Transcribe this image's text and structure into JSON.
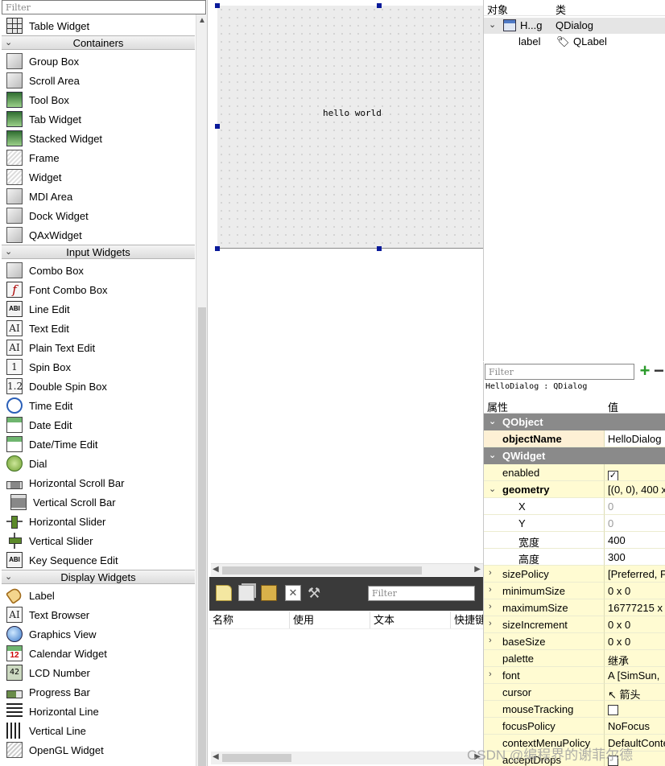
{
  "widget_box": {
    "filter_placeholder": "Filter",
    "items": [
      {
        "type": "item",
        "label": "Table Widget",
        "icon": "table-icon"
      },
      {
        "type": "category",
        "label": "Containers"
      },
      {
        "type": "item",
        "label": "Group Box",
        "icon": "group-box-icon"
      },
      {
        "type": "item",
        "label": "Scroll Area",
        "icon": "scroll-area-icon"
      },
      {
        "type": "item",
        "label": "Tool Box",
        "icon": "tool-box-icon"
      },
      {
        "type": "item",
        "label": "Tab Widget",
        "icon": "tab-widget-icon"
      },
      {
        "type": "item",
        "label": "Stacked Widget",
        "icon": "stacked-widget-icon"
      },
      {
        "type": "item",
        "label": "Frame",
        "icon": "frame-icon"
      },
      {
        "type": "item",
        "label": "Widget",
        "icon": "widget-icon"
      },
      {
        "type": "item",
        "label": "MDI Area",
        "icon": "mdi-area-icon"
      },
      {
        "type": "item",
        "label": "Dock Widget",
        "icon": "dock-widget-icon"
      },
      {
        "type": "item",
        "label": "QAxWidget",
        "icon": "qaxwidget-icon"
      },
      {
        "type": "category",
        "label": "Input Widgets"
      },
      {
        "type": "item",
        "label": "Combo Box",
        "icon": "combo-box-icon"
      },
      {
        "type": "item",
        "label": "Font Combo Box",
        "icon": "font-combo-box-icon"
      },
      {
        "type": "item",
        "label": "Line Edit",
        "icon": "line-edit-icon"
      },
      {
        "type": "item",
        "label": "Text Edit",
        "icon": "text-edit-icon"
      },
      {
        "type": "item",
        "label": "Plain Text Edit",
        "icon": "plain-text-edit-icon"
      },
      {
        "type": "item",
        "label": "Spin Box",
        "icon": "spin-box-icon"
      },
      {
        "type": "item",
        "label": "Double Spin Box",
        "icon": "double-spin-box-icon"
      },
      {
        "type": "item",
        "label": "Time Edit",
        "icon": "time-edit-icon"
      },
      {
        "type": "item",
        "label": "Date Edit",
        "icon": "date-edit-icon"
      },
      {
        "type": "item",
        "label": "Date/Time Edit",
        "icon": "datetime-edit-icon"
      },
      {
        "type": "item",
        "label": "Dial",
        "icon": "dial-icon"
      },
      {
        "type": "item",
        "label": "Horizontal Scroll Bar",
        "icon": "horizontal-scroll-bar-icon"
      },
      {
        "type": "item",
        "label": "Vertical Scroll Bar",
        "icon": "vertical-scroll-bar-icon"
      },
      {
        "type": "item",
        "label": "Horizontal Slider",
        "icon": "horizontal-slider-icon"
      },
      {
        "type": "item",
        "label": "Vertical Slider",
        "icon": "vertical-slider-icon"
      },
      {
        "type": "item",
        "label": "Key Sequence Edit",
        "icon": "key-sequence-edit-icon"
      },
      {
        "type": "category",
        "label": "Display Widgets"
      },
      {
        "type": "item",
        "label": "Label",
        "icon": "label-icon"
      },
      {
        "type": "item",
        "label": "Text Browser",
        "icon": "text-browser-icon"
      },
      {
        "type": "item",
        "label": "Graphics View",
        "icon": "graphics-view-icon"
      },
      {
        "type": "item",
        "label": "Calendar Widget",
        "icon": "calendar-widget-icon"
      },
      {
        "type": "item",
        "label": "LCD Number",
        "icon": "lcd-number-icon"
      },
      {
        "type": "item",
        "label": "Progress Bar",
        "icon": "progress-bar-icon"
      },
      {
        "type": "item",
        "label": "Horizontal Line",
        "icon": "horizontal-line-icon"
      },
      {
        "type": "item",
        "label": "Vertical Line",
        "icon": "vertical-line-icon"
      },
      {
        "type": "item",
        "label": "OpenGL Widget",
        "icon": "opengl-widget-icon"
      }
    ]
  },
  "form": {
    "label_text": "hello world"
  },
  "action_editor": {
    "filter_placeholder": "Filter",
    "columns": [
      "名称",
      "使用",
      "文本",
      "快捷键"
    ]
  },
  "object_inspector": {
    "header_object": "对象",
    "header_class": "类",
    "rows": [
      {
        "object": "H...g",
        "class": "QDialog"
      },
      {
        "object": "label",
        "class": "QLabel"
      }
    ]
  },
  "property_editor": {
    "filter_placeholder": "Filter",
    "class_line": "HelloDialog : QDialog",
    "header_property": "属性",
    "header_value": "值",
    "rows": [
      {
        "kind": "group",
        "name": "QObject"
      },
      {
        "kind": "obj",
        "name": "objectName",
        "value": "HelloDialog"
      },
      {
        "kind": "group",
        "name": "QWidget"
      },
      {
        "kind": "wid",
        "name": "enabled",
        "value": "",
        "check": true,
        "checked": true
      },
      {
        "kind": "wid",
        "name": "geometry",
        "value": "[(0, 0), 400 x",
        "expander": "open",
        "bold": true
      },
      {
        "kind": "sub",
        "name": "X",
        "value": "0",
        "muted": true
      },
      {
        "kind": "sub",
        "name": "Y",
        "value": "0",
        "muted": true
      },
      {
        "kind": "sub",
        "name": "宽度",
        "value": "400"
      },
      {
        "kind": "sub",
        "name": "高度",
        "value": "300"
      },
      {
        "kind": "wid",
        "name": "sizePolicy",
        "value": "[Preferred, P",
        "expander": "closed"
      },
      {
        "kind": "wid",
        "name": "minimumSize",
        "value": "0 x 0",
        "expander": "closed"
      },
      {
        "kind": "wid",
        "name": "maximumSize",
        "value": "16777215 x",
        "expander": "closed"
      },
      {
        "kind": "wid",
        "name": "sizeIncrement",
        "value": "0 x 0",
        "expander": "closed"
      },
      {
        "kind": "wid",
        "name": "baseSize",
        "value": "0 x 0",
        "expander": "closed"
      },
      {
        "kind": "wid",
        "name": "palette",
        "value": "继承"
      },
      {
        "kind": "wid",
        "name": "font",
        "value": "[SimSun,",
        "expander": "closed",
        "prefix": "A"
      },
      {
        "kind": "wid",
        "name": "cursor",
        "value": "箭头",
        "prefix": "↖"
      },
      {
        "kind": "wid",
        "name": "mouseTracking",
        "value": "",
        "check": true,
        "checked": false
      },
      {
        "kind": "wid",
        "name": "focusPolicy",
        "value": "NoFocus"
      },
      {
        "kind": "wid",
        "name": "contextMenuPolicy",
        "value": "DefaultConte"
      },
      {
        "kind": "wid",
        "name": "acceptDrops",
        "value": "",
        "check": true,
        "checked": false
      }
    ]
  },
  "watermark": "CSDN @编程界的谢菲尔德"
}
